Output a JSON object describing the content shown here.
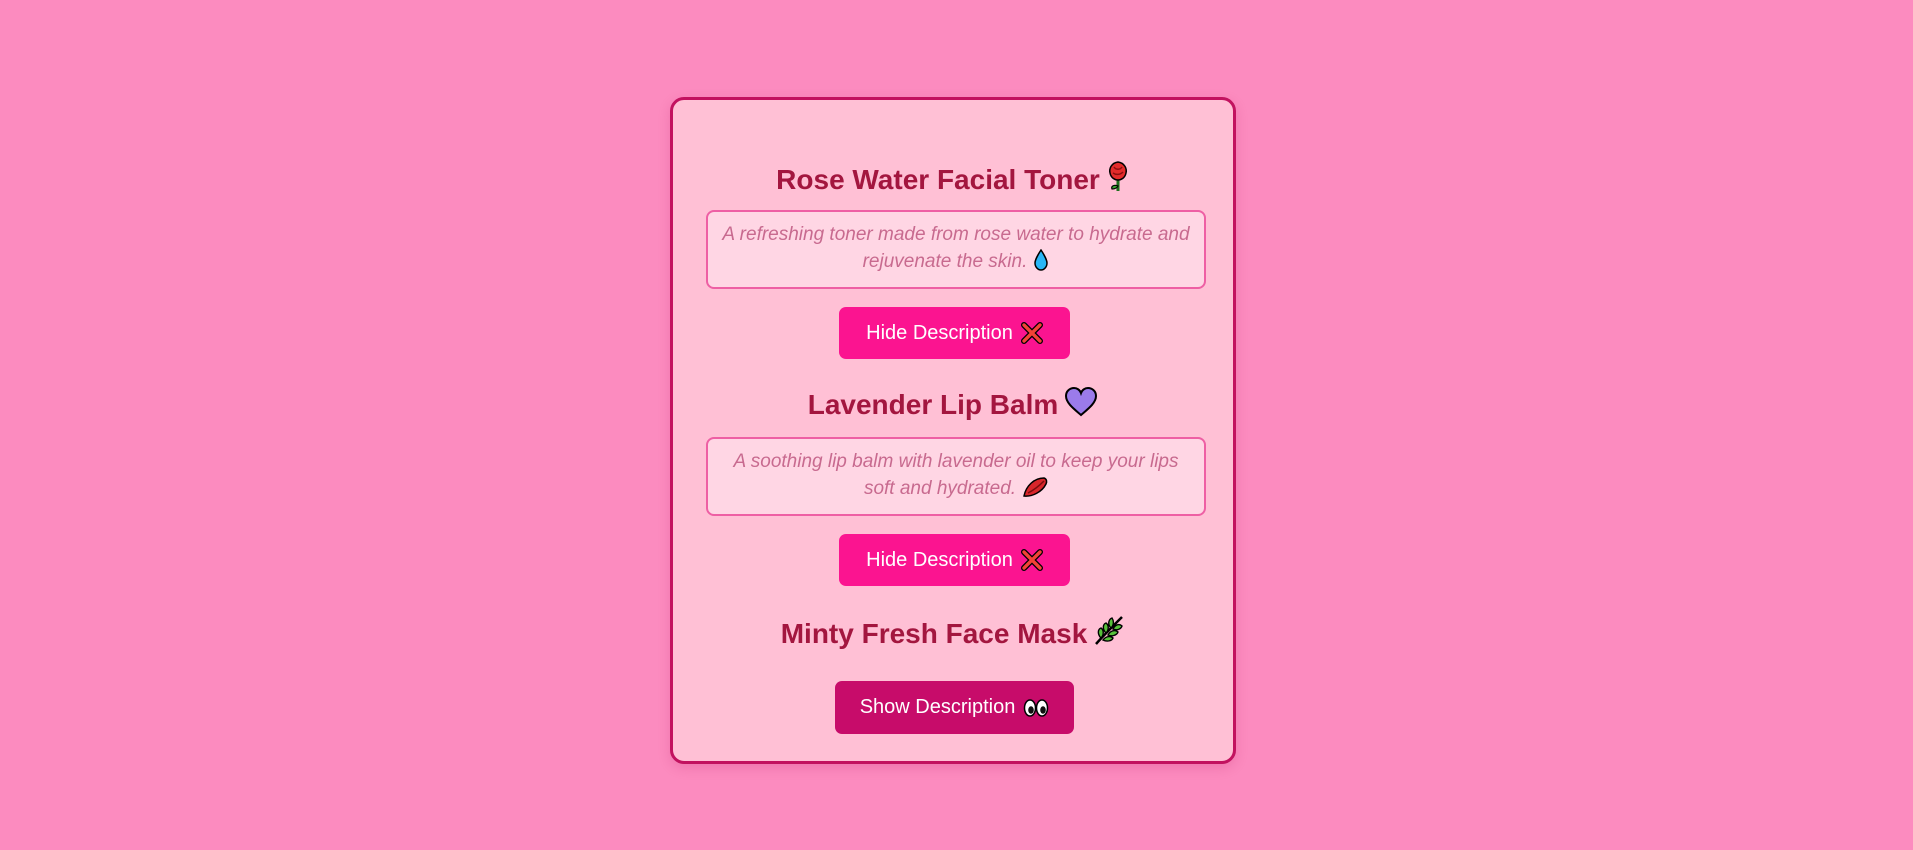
{
  "products": [
    {
      "name": "Rose Water Facial Toner",
      "name_icon": "rose-icon",
      "description": "A refreshing toner made from rose water to hydrate and rejuvenate the skin.",
      "description_icon": "droplet-icon",
      "button_label": "Hide Description",
      "button_icon": "cross-mark-icon"
    },
    {
      "name": "Lavender Lip Balm",
      "name_icon": "purple-heart-icon",
      "description": "A soothing lip balm with lavender oil to keep your lips soft and hydrated.",
      "description_icon": "lips-icon",
      "button_label": "Hide Description",
      "button_icon": "cross-mark-icon"
    },
    {
      "name": "Minty Fresh Face Mask",
      "name_icon": "herb-leaf-icon",
      "button_label": "Show Description",
      "button_icon": "eyes-icon"
    }
  ],
  "colors": {
    "page_background": "#fc8bbf",
    "card_background": "#ffc0d5",
    "card_border": "#c2125f",
    "title_text": "#a3163f",
    "description_background": "#ffd6e4",
    "description_border": "#ee5fa4",
    "description_text": "#c86a8f",
    "hide_button": "#fb1490",
    "show_button": "#c70c6a"
  }
}
